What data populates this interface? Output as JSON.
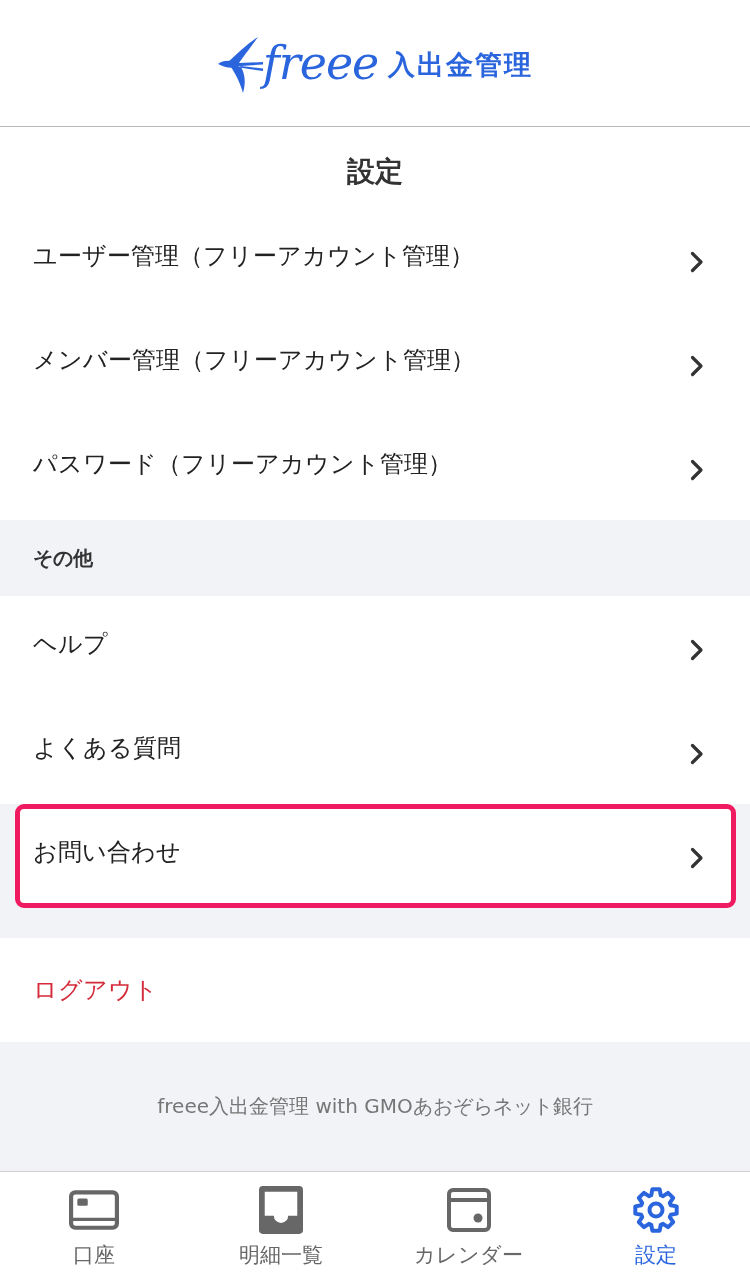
{
  "header": {
    "logo_wordmark": "freee",
    "logo_product": "入出金管理"
  },
  "page_title": "設定",
  "sections": [
    {
      "items": [
        {
          "label": "ユーザー管理（フリーアカウント管理）",
          "highlighted": false
        },
        {
          "label": "メンバー管理（フリーアカウント管理）",
          "highlighted": false
        },
        {
          "label": "パスワード（フリーアカウント管理）",
          "highlighted": false
        }
      ]
    },
    {
      "heading": "その他",
      "items": [
        {
          "label": "ヘルプ",
          "highlighted": false
        },
        {
          "label": "よくある質問",
          "highlighted": false
        },
        {
          "label": "お問い合わせ",
          "highlighted": true
        }
      ]
    }
  ],
  "logout_button": {
    "label": "ログアウト"
  },
  "footer": {
    "text": "freee入出金管理 with GMOあおぞらネット銀行"
  },
  "tab_bar": [
    {
      "kind": "card",
      "label": "口座",
      "selected": false
    },
    {
      "kind": "tray",
      "label": "明細一覧",
      "selected": false
    },
    {
      "kind": "calendar",
      "label": "カレンダー",
      "selected": false
    },
    {
      "kind": "gear",
      "label": "設定",
      "selected": true
    }
  ]
}
